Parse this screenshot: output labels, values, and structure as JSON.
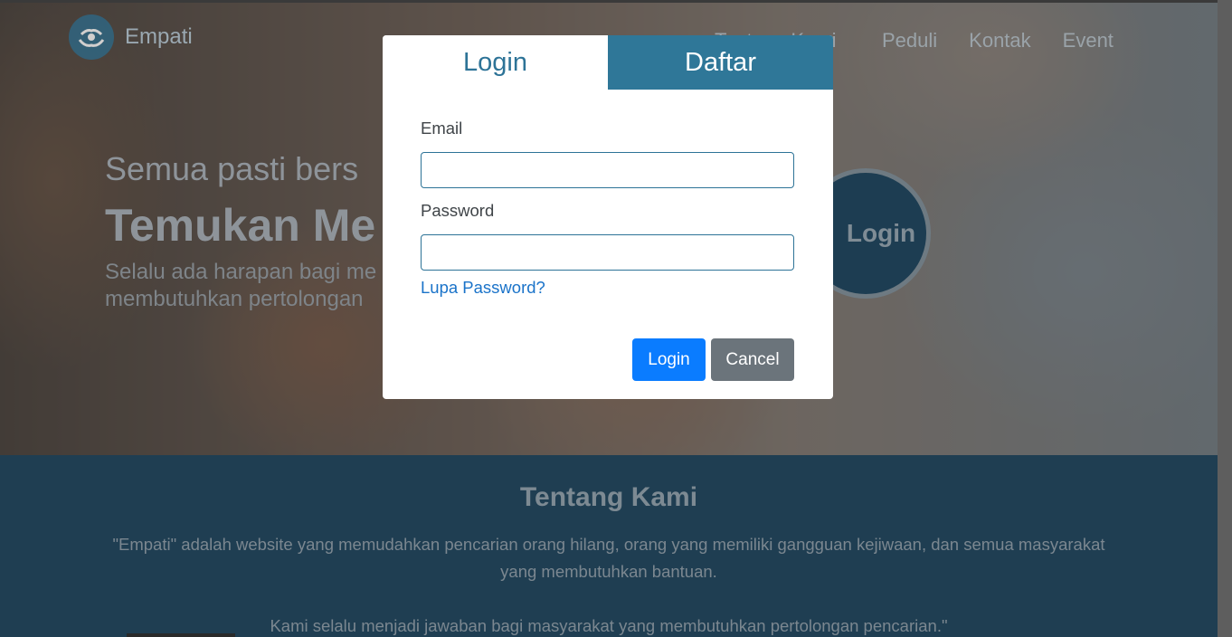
{
  "brand": {
    "name": "Empati"
  },
  "nav": {
    "items": [
      "Tentang Kami",
      "Peduli",
      "Kontak",
      "Event"
    ]
  },
  "hero": {
    "subtitle": "Semua pasti bers",
    "title": "Temukan Me",
    "description": "Selalu ada harapan bagi me membutuhkan pertolongan",
    "login_label": "Login"
  },
  "about": {
    "title": "Tentang Kami",
    "paragraph1": "\"Empati\" adalah website yang memudahkan pencarian orang hilang, orang yang memiliki gangguan kejiwaan, dan semua masyarakat yang membutuhkan bantuan.",
    "paragraph2": "Kami selalu menjadi jawaban bagi masyarakat yang membutuhkan pertolongan pencarian.\""
  },
  "modal": {
    "tabs": {
      "login": "Login",
      "register": "Daftar"
    },
    "email_label": "Email",
    "email_value": "",
    "password_label": "Password",
    "password_value": "",
    "forgot_label": "Lupa Password?",
    "login_button": "Login",
    "cancel_button": "Cancel"
  },
  "colors": {
    "accent": "#2f7798",
    "primary_button": "#0a7cff",
    "secondary_button": "#6b747b",
    "section_bg": "#1f3e52"
  }
}
